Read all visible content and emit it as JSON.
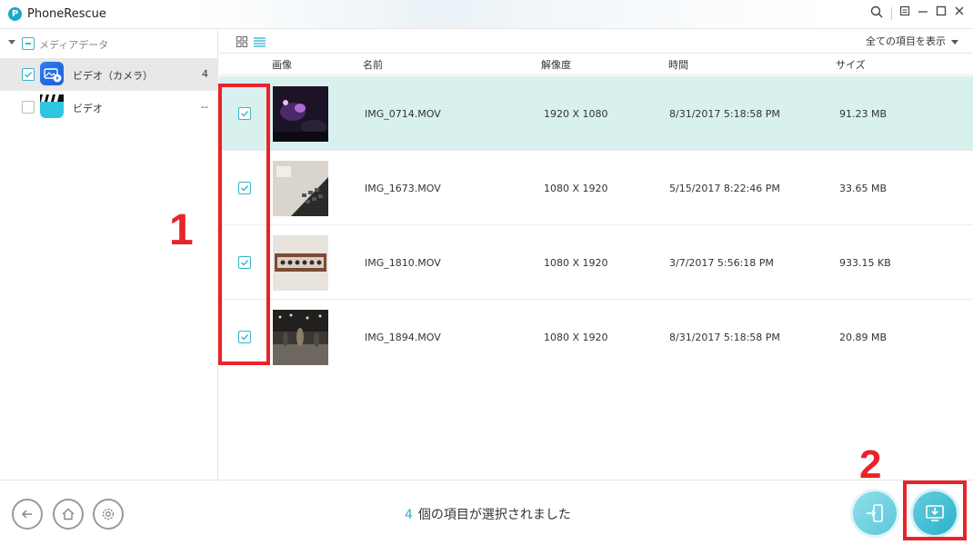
{
  "app": {
    "title": "PhoneRescue",
    "logo_letter": "P"
  },
  "window_controls": [
    "search-icon",
    "menu-icon",
    "minimize-icon",
    "maximize-icon",
    "close-icon"
  ],
  "sidebar": {
    "root_label": "メディアデータ",
    "items": [
      {
        "label": "ビデオ（カメラ）",
        "count": "4",
        "checked": true,
        "selected": true,
        "icon": "camera-video-icon"
      },
      {
        "label": "ビデオ",
        "count": "--",
        "checked": false,
        "selected": false,
        "icon": "clapperboard-icon"
      }
    ]
  },
  "toolbar": {
    "filter_label": "全ての項目を表示"
  },
  "table": {
    "columns": [
      "画像",
      "名前",
      "解像度",
      "時間",
      "サイズ"
    ],
    "rows": [
      {
        "name": "IMG_0714.MOV",
        "resolution": "1920 X 1080",
        "time": "8/31/2017 5:18:58 PM",
        "size": "91.23 MB",
        "checked": true
      },
      {
        "name": "IMG_1673.MOV",
        "resolution": "1080 X 1920",
        "time": "5/15/2017 8:22:46 PM",
        "size": "33.65 MB",
        "checked": true
      },
      {
        "name": "IMG_1810.MOV",
        "resolution": "1080 X 1920",
        "time": "3/7/2017 5:56:18 PM",
        "size": "933.15 KB",
        "checked": true
      },
      {
        "name": "IMG_1894.MOV",
        "resolution": "1080 X 1920",
        "time": "8/31/2017 5:18:58 PM",
        "size": "20.89 MB",
        "checked": true
      }
    ]
  },
  "annotations": {
    "label_1": "1",
    "label_2": "2"
  },
  "footer": {
    "selected_count": "4",
    "status_text": "個の項目が選択されました",
    "buttons": [
      "back-icon",
      "home-icon",
      "settings-icon"
    ],
    "actions": [
      "to-device-icon",
      "to-computer-icon"
    ]
  },
  "colors": {
    "accent": "#2bb3c9",
    "highlight_row": "#d9f1ee",
    "annotation": "#e8232a"
  }
}
